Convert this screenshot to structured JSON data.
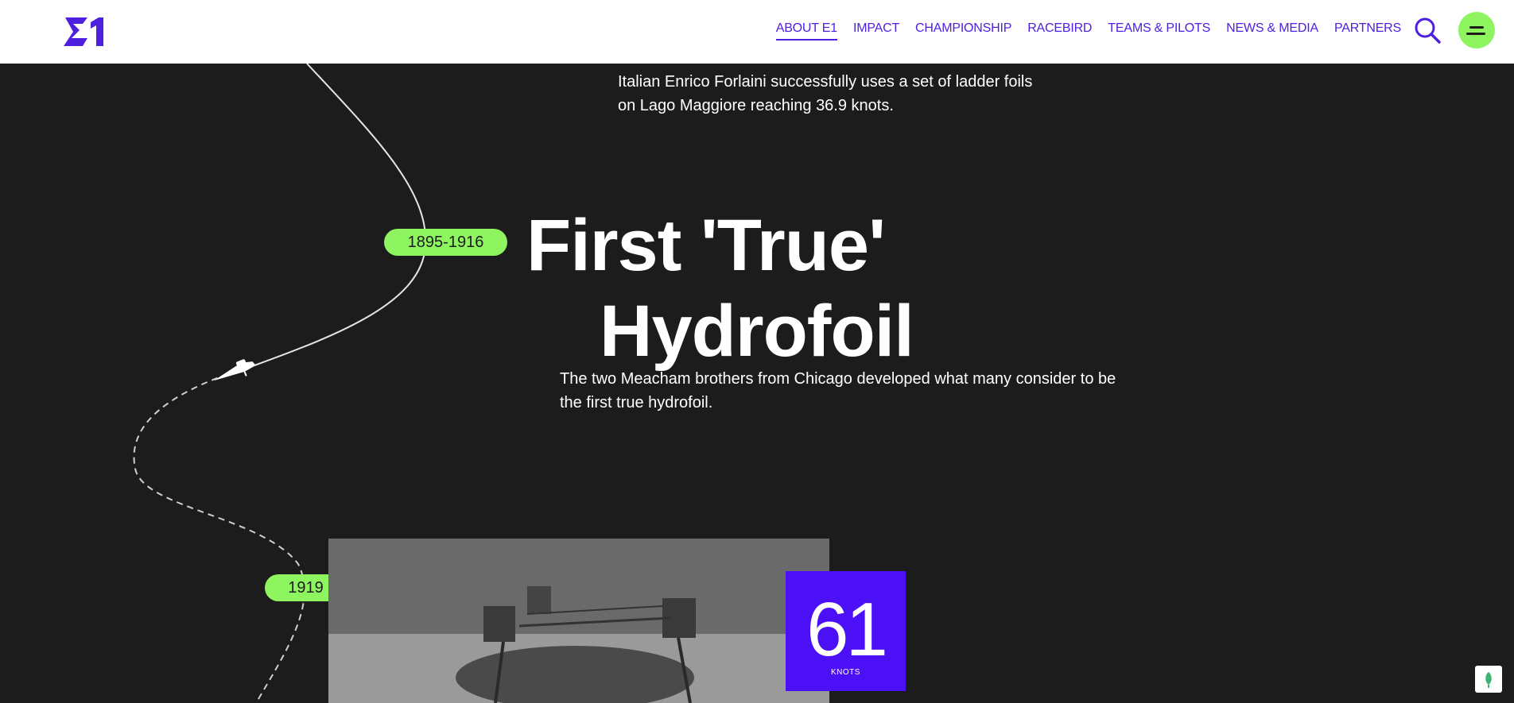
{
  "header": {
    "logo_alt": "E1",
    "nav": [
      {
        "label": "ABOUT E1",
        "active": true
      },
      {
        "label": "IMPACT",
        "active": false
      },
      {
        "label": "CHAMPIONSHIP",
        "active": false
      },
      {
        "label": "RACEBIRD",
        "active": false
      },
      {
        "label": "TEAMS & PILOTS",
        "active": false
      },
      {
        "label": "NEWS & MEDIA",
        "active": false
      },
      {
        "label": "PARTNERS",
        "active": false
      }
    ],
    "icons": {
      "search": "search-icon",
      "menu": "menu-icon"
    }
  },
  "timeline": {
    "previous_text": "Italian Enrico Forlaini successfully uses a set of ladder foils on Lago Maggiore reaching 36.9 knots.",
    "current": {
      "year": "1895-1916",
      "title_line1": "First 'True'",
      "title_line2": "Hydrofoil",
      "description": "The two Meacham brothers from Chicago developed what many consider to be the first true hydrofoil."
    },
    "next": {
      "year": "1919",
      "speed_value": "61",
      "speed_unit": "KNOTS"
    }
  },
  "colors": {
    "accent_purple": "#4f1fe0",
    "speed_purple": "#4b10f5",
    "accent_green": "#8ef560",
    "background": "#1c1c1c"
  }
}
